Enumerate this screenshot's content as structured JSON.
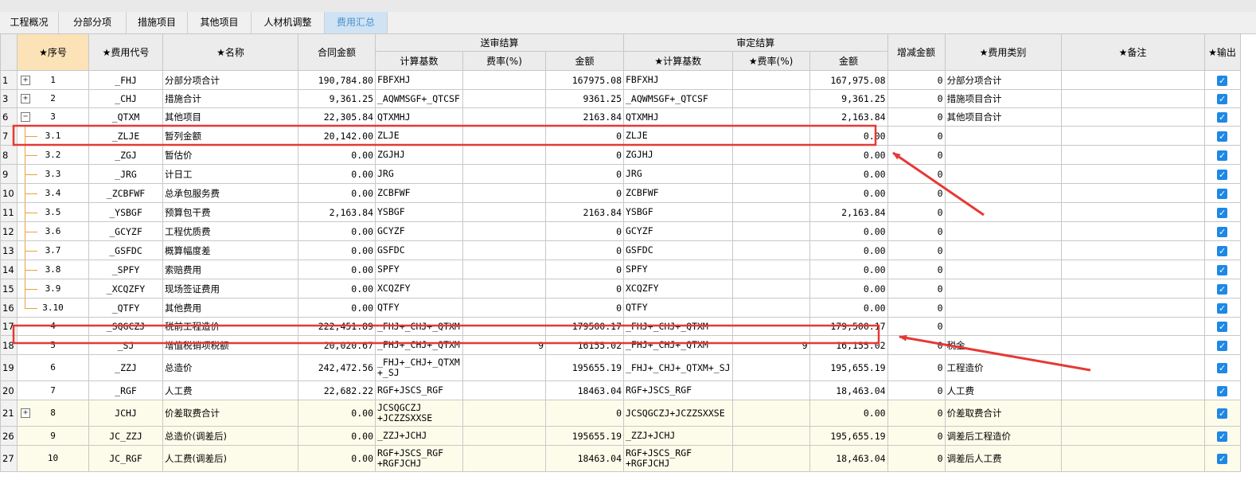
{
  "tabs": [
    "工程概况",
    "分部分项",
    "措施项目",
    "其他项目",
    "人材机调整",
    "费用汇总"
  ],
  "active_tab": "费用汇总",
  "headers": {
    "seq": "★序号",
    "code": "★费用代号",
    "name": "★名称",
    "contract": "合同金额",
    "group_submit": "送审结算",
    "sub_base": "计算基数",
    "sub_rate": "费率(%)",
    "sub_amount": "金额",
    "group_approved": "审定结算",
    "ap_base": "★计算基数",
    "ap_rate": "★费率(%)",
    "ap_amount": "金额",
    "delta": "增减金额",
    "category": "★费用类别",
    "remark": "★备注",
    "output": "★输出"
  },
  "rows": [
    {
      "rn": "1",
      "seq": "1",
      "code": "_FHJ",
      "name": "分部分项合计",
      "contract": "190,784.80",
      "sbase": "FBFXHJ",
      "srate": "",
      "samount": "167975.08",
      "abase": "FBFXHJ",
      "arate": "",
      "aamount": "167,975.08",
      "delta": "0",
      "cat": "分部分项合计",
      "remark": ""
    },
    {
      "rn": "3",
      "seq": "2",
      "code": "_CHJ",
      "name": "措施合计",
      "contract": "9,361.25",
      "sbase": "_AQWMSGF+_QTCSF",
      "srate": "",
      "samount": "9361.25",
      "abase": "_AQWMSGF+_QTCSF",
      "arate": "",
      "aamount": "9,361.25",
      "delta": "0",
      "cat": "措施项目合计",
      "remark": ""
    },
    {
      "rn": "6",
      "seq": "3",
      "code": "_QTXM",
      "name": "其他项目",
      "contract": "22,305.84",
      "sbase": "QTXMHJ",
      "srate": "",
      "samount": "2163.84",
      "abase": "QTXMHJ",
      "arate": "",
      "aamount": "2,163.84",
      "delta": "0",
      "cat": "其他项目合计",
      "remark": ""
    },
    {
      "rn": "7",
      "seq": "3.1",
      "code": "_ZLJE",
      "name": "暂列金额",
      "contract": "20,142.00",
      "sbase": "ZLJE",
      "srate": "",
      "samount": "0",
      "abase": "ZLJE",
      "arate": "",
      "aamount": "0.00",
      "delta": "0",
      "cat": "",
      "remark": ""
    },
    {
      "rn": "8",
      "seq": "3.2",
      "code": "_ZGJ",
      "name": "暂估价",
      "contract": "0.00",
      "sbase": "ZGJHJ",
      "srate": "",
      "samount": "0",
      "abase": "ZGJHJ",
      "arate": "",
      "aamount": "0.00",
      "delta": "0",
      "cat": "",
      "remark": ""
    },
    {
      "rn": "9",
      "seq": "3.3",
      "code": "_JRG",
      "name": "计日工",
      "contract": "0.00",
      "sbase": "JRG",
      "srate": "",
      "samount": "0",
      "abase": "JRG",
      "arate": "",
      "aamount": "0.00",
      "delta": "0",
      "cat": "",
      "remark": ""
    },
    {
      "rn": "10",
      "seq": "3.4",
      "code": "_ZCBFWF",
      "name": "总承包服务费",
      "contract": "0.00",
      "sbase": "ZCBFWF",
      "srate": "",
      "samount": "0",
      "abase": "ZCBFWF",
      "arate": "",
      "aamount": "0.00",
      "delta": "0",
      "cat": "",
      "remark": ""
    },
    {
      "rn": "11",
      "seq": "3.5",
      "code": "_YSBGF",
      "name": "预算包干费",
      "contract": "2,163.84",
      "sbase": "YSBGF",
      "srate": "",
      "samount": "2163.84",
      "abase": "YSBGF",
      "arate": "",
      "aamount": "2,163.84",
      "delta": "0",
      "cat": "",
      "remark": ""
    },
    {
      "rn": "12",
      "seq": "3.6",
      "code": "_GCYZF",
      "name": "工程优质费",
      "contract": "0.00",
      "sbase": "GCYZF",
      "srate": "",
      "samount": "0",
      "abase": "GCYZF",
      "arate": "",
      "aamount": "0.00",
      "delta": "0",
      "cat": "",
      "remark": ""
    },
    {
      "rn": "13",
      "seq": "3.7",
      "code": "_GSFDC",
      "name": "概算幅度差",
      "contract": "0.00",
      "sbase": "GSFDC",
      "srate": "",
      "samount": "0",
      "abase": "GSFDC",
      "arate": "",
      "aamount": "0.00",
      "delta": "0",
      "cat": "",
      "remark": ""
    },
    {
      "rn": "14",
      "seq": "3.8",
      "code": "_SPFY",
      "name": "索赔费用",
      "contract": "0.00",
      "sbase": "SPFY",
      "srate": "",
      "samount": "0",
      "abase": "SPFY",
      "arate": "",
      "aamount": "0.00",
      "delta": "0",
      "cat": "",
      "remark": ""
    },
    {
      "rn": "15",
      "seq": "3.9",
      "code": "_XCQZFY",
      "name": "现场签证费用",
      "contract": "0.00",
      "sbase": "XCQZFY",
      "srate": "",
      "samount": "0",
      "abase": "XCQZFY",
      "arate": "",
      "aamount": "0.00",
      "delta": "0",
      "cat": "",
      "remark": ""
    },
    {
      "rn": "16",
      "seq": "3.10",
      "code": "_QTFY",
      "name": "其他费用",
      "contract": "0.00",
      "sbase": "QTFY",
      "srate": "",
      "samount": "0",
      "abase": "QTFY",
      "arate": "",
      "aamount": "0.00",
      "delta": "0",
      "cat": "",
      "remark": ""
    },
    {
      "rn": "17",
      "seq": "4",
      "code": "_SQGCZJ",
      "name": "税前工程造价",
      "contract": "222,451.89",
      "sbase": "_FHJ+_CHJ+_QTXM",
      "srate": "",
      "samount": "179500.17",
      "abase": "_FHJ+_CHJ+_QTXM",
      "arate": "",
      "aamount": "179,500.17",
      "delta": "0",
      "cat": "",
      "remark": ""
    },
    {
      "rn": "18",
      "seq": "5",
      "code": "_SJ",
      "name": "增值税销项税额",
      "contract": "20,020.67",
      "sbase": "_FHJ+_CHJ+_QTXM",
      "srate": "9",
      "samount": "16155.02",
      "abase": "_FHJ+_CHJ+_QTXM",
      "arate": "9",
      "aamount": "16,155.02",
      "delta": "0",
      "cat": "税金",
      "remark": ""
    },
    {
      "rn": "19",
      "seq": "6",
      "code": "_ZZJ",
      "name": "总造价",
      "contract": "242,472.56",
      "sbase": "_FHJ+_CHJ+_QTXM\n+_SJ",
      "srate": "",
      "samount": "195655.19",
      "abase": "_FHJ+_CHJ+_QTXM+_SJ",
      "arate": "",
      "aamount": "195,655.19",
      "delta": "0",
      "cat": "工程造价",
      "remark": ""
    },
    {
      "rn": "20",
      "seq": "7",
      "code": "_RGF",
      "name": "人工费",
      "contract": "22,682.22",
      "sbase": "RGF+JSCS_RGF",
      "srate": "",
      "samount": "18463.04",
      "abase": "RGF+JSCS_RGF",
      "arate": "",
      "aamount": "18,463.04",
      "delta": "0",
      "cat": "人工费",
      "remark": ""
    },
    {
      "rn": "21",
      "seq": "8",
      "code": "JCHJ",
      "name": "价差取费合计",
      "contract": "0.00",
      "sbase": "JCSQGCZJ\n+JCZZSXXSE",
      "srate": "",
      "samount": "0",
      "abase": "JCSQGCZJ+JCZZSXXSE",
      "arate": "",
      "aamount": "0.00",
      "delta": "0",
      "cat": "价差取费合计",
      "remark": ""
    },
    {
      "rn": "26",
      "seq": "9",
      "code": "JC_ZZJ",
      "name": "总造价(调差后)",
      "contract": "0.00",
      "sbase": "_ZZJ+JCHJ",
      "srate": "",
      "samount": "195655.19",
      "abase": "_ZZJ+JCHJ",
      "arate": "",
      "aamount": "195,655.19",
      "delta": "0",
      "cat": "调差后工程造价",
      "remark": ""
    },
    {
      "rn": "27",
      "seq": "10",
      "code": "JC_RGF",
      "name": "人工费(调差后)",
      "contract": "0.00",
      "sbase": "RGF+JSCS_RGF\n+RGFJCHJ",
      "srate": "",
      "samount": "18463.04",
      "abase": "RGF+JSCS_RGF\n+RGFJCHJ",
      "arate": "",
      "aamount": "18,463.04",
      "delta": "0",
      "cat": "调差后人工费",
      "remark": ""
    }
  ],
  "output_checked_mark": "✓",
  "expand_plus": "+",
  "expand_minus": "−",
  "colors": {
    "annotation_red": "#e53935",
    "checkbox_blue": "#1e88e5",
    "active_tab": "#cfe3f5",
    "header_highlight": "#fbe2b7",
    "tree_line": "#e5a53a"
  }
}
